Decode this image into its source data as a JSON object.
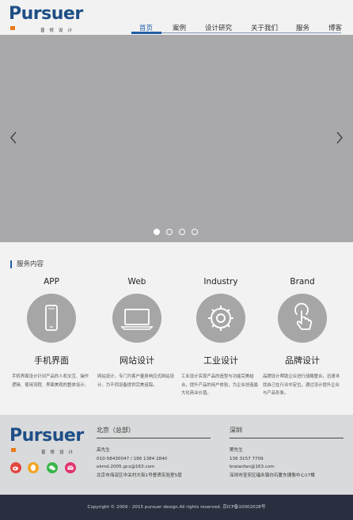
{
  "brand": {
    "name": "Pursuer",
    "tagline": "普修设计"
  },
  "nav": {
    "items": [
      "首页",
      "案例",
      "设计研究",
      "关于我们",
      "服务",
      "博客"
    ],
    "active": "首页"
  },
  "banner": {
    "slides": 4,
    "active_slide": 1
  },
  "services": {
    "heading": "服务内容",
    "items": [
      {
        "en": "APP",
        "cn": "手机界面",
        "icon": "smartphone-icon",
        "desc": "手机界面设计针对产品的人机交互、操作逻辑、使用流程、界面美观的整体设计。"
      },
      {
        "en": "Web",
        "cn": "网站设计",
        "icon": "laptop-icon",
        "desc": "网站设计，专门为客户量身响应式网站设计，为不同设备提供完美追踪。"
      },
      {
        "en": "Industry",
        "cn": "工业设计",
        "icon": "gear-icon",
        "desc": "工业设计实现产品的造型与功能完美结合，提升产品的用户体验，为企业创造最大化商业价值。"
      },
      {
        "en": "Brand",
        "cn": "品牌设计",
        "icon": "touch-hand-icon",
        "desc": "品牌设计帮助企业进行战略整合，迅速寻找自己在行业中定位，通过设计提升企业与产品形象。"
      }
    ]
  },
  "footer": {
    "beijing": {
      "title": "北京（总部）",
      "lines": [
        "高先生",
        "010-58430047 / 186 1384 2840",
        "ekmd.2005.gcx@163.com",
        "北京市海淀区中关村大街1号督贤实验室5层"
      ]
    },
    "shenzhen": {
      "title": "深圳",
      "lines": [
        "樊先生",
        "136 3157 7709",
        "braianfan@163.com",
        "深圳市宝安区福永镇白石厦东捷衡中心17楼"
      ]
    },
    "social": [
      "weibo-icon",
      "qq-icon",
      "wechat-icon",
      "email-icon"
    ],
    "colors": {
      "weibo": "#e2473d",
      "qq": "#f2a523",
      "wechat": "#3bb54a",
      "email": "#e0336e"
    }
  },
  "copyright": "Copyright © 2009 - 2015 pursuer design.All rights reserved. 京ICP备10002028号",
  "colors": {
    "brand_blue": "#1e4f86",
    "accent": "#e87a1c",
    "banner": "#a9a9ab",
    "footer_dark": "#2a2f3f"
  }
}
